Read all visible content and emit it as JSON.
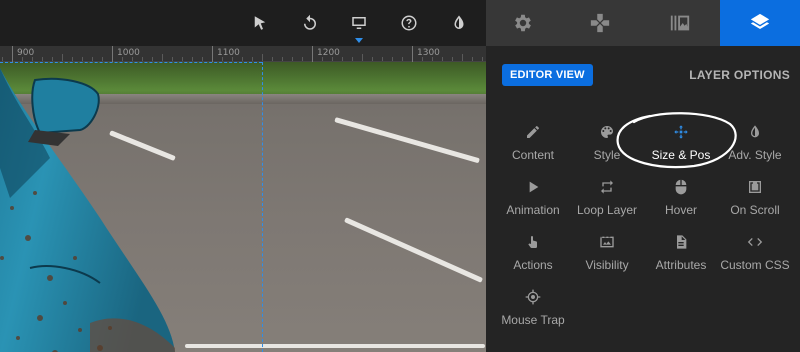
{
  "toolbar": {
    "tools": [
      {
        "name": "select-tool",
        "icon": "cursor-arrow-icon"
      },
      {
        "name": "undo-tool",
        "icon": "undo-icon"
      },
      {
        "name": "desktop-view-tool",
        "icon": "monitor-icon",
        "active": true
      },
      {
        "name": "help-tool",
        "icon": "help-circle-icon"
      },
      {
        "name": "contrast-tool",
        "icon": "contrast-drop-icon"
      }
    ]
  },
  "ruler": {
    "labels": [
      "900",
      "1000",
      "1100",
      "1200",
      "1300"
    ]
  },
  "panel": {
    "tabs": [
      {
        "icon": "gear-icon",
        "active": false
      },
      {
        "icon": "gamepad-icon",
        "active": false
      },
      {
        "icon": "media-library-icon",
        "active": false
      },
      {
        "icon": "layers-icon",
        "active": true
      }
    ],
    "editor_view_label": "EDITOR VIEW",
    "layer_options_label": "LAYER OPTIONS",
    "options": [
      {
        "label": "Content",
        "icon": "pencil-icon"
      },
      {
        "label": "Style",
        "icon": "palette-icon"
      },
      {
        "label": "Size & Pos",
        "icon": "move-arrows-icon",
        "active": true
      },
      {
        "label": "Adv. Style",
        "icon": "contrast-drop-icon"
      },
      {
        "label": "Animation",
        "icon": "play-icon"
      },
      {
        "label": "Loop Layer",
        "icon": "loop-icon"
      },
      {
        "label": "Hover",
        "icon": "mouse-icon"
      },
      {
        "label": "On Scroll",
        "icon": "scroll-download-icon"
      },
      {
        "label": "Actions",
        "icon": "pointer-hand-icon"
      },
      {
        "label": "Visibility",
        "icon": "visibility-icon"
      },
      {
        "label": "Attributes",
        "icon": "document-icon"
      },
      {
        "label": "Custom CSS",
        "icon": "code-icon"
      },
      {
        "label": "Mouse Trap",
        "icon": "crosshair-icon"
      }
    ]
  },
  "colors": {
    "accent": "#0b6ee0",
    "panel_bg": "#242424",
    "tab_bg": "#373737"
  }
}
